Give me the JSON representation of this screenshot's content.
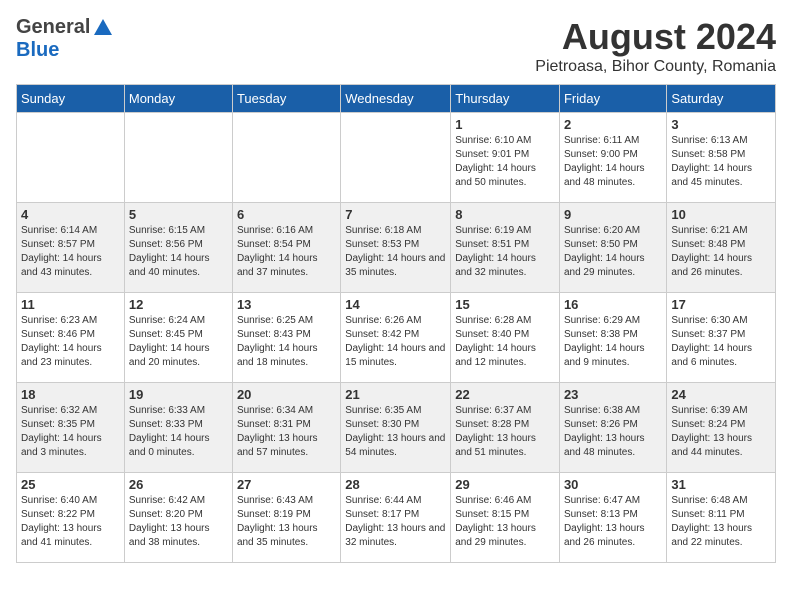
{
  "logo": {
    "general": "General",
    "blue": "Blue"
  },
  "title": {
    "month_year": "August 2024",
    "location": "Pietroasa, Bihor County, Romania"
  },
  "weekdays": [
    "Sunday",
    "Monday",
    "Tuesday",
    "Wednesday",
    "Thursday",
    "Friday",
    "Saturday"
  ],
  "weeks": [
    [
      {
        "day": "",
        "info": ""
      },
      {
        "day": "",
        "info": ""
      },
      {
        "day": "",
        "info": ""
      },
      {
        "day": "",
        "info": ""
      },
      {
        "day": "1",
        "info": "Sunrise: 6:10 AM\nSunset: 9:01 PM\nDaylight: 14 hours and 50 minutes."
      },
      {
        "day": "2",
        "info": "Sunrise: 6:11 AM\nSunset: 9:00 PM\nDaylight: 14 hours and 48 minutes."
      },
      {
        "day": "3",
        "info": "Sunrise: 6:13 AM\nSunset: 8:58 PM\nDaylight: 14 hours and 45 minutes."
      }
    ],
    [
      {
        "day": "4",
        "info": "Sunrise: 6:14 AM\nSunset: 8:57 PM\nDaylight: 14 hours and 43 minutes."
      },
      {
        "day": "5",
        "info": "Sunrise: 6:15 AM\nSunset: 8:56 PM\nDaylight: 14 hours and 40 minutes."
      },
      {
        "day": "6",
        "info": "Sunrise: 6:16 AM\nSunset: 8:54 PM\nDaylight: 14 hours and 37 minutes."
      },
      {
        "day": "7",
        "info": "Sunrise: 6:18 AM\nSunset: 8:53 PM\nDaylight: 14 hours and 35 minutes."
      },
      {
        "day": "8",
        "info": "Sunrise: 6:19 AM\nSunset: 8:51 PM\nDaylight: 14 hours and 32 minutes."
      },
      {
        "day": "9",
        "info": "Sunrise: 6:20 AM\nSunset: 8:50 PM\nDaylight: 14 hours and 29 minutes."
      },
      {
        "day": "10",
        "info": "Sunrise: 6:21 AM\nSunset: 8:48 PM\nDaylight: 14 hours and 26 minutes."
      }
    ],
    [
      {
        "day": "11",
        "info": "Sunrise: 6:23 AM\nSunset: 8:46 PM\nDaylight: 14 hours and 23 minutes."
      },
      {
        "day": "12",
        "info": "Sunrise: 6:24 AM\nSunset: 8:45 PM\nDaylight: 14 hours and 20 minutes."
      },
      {
        "day": "13",
        "info": "Sunrise: 6:25 AM\nSunset: 8:43 PM\nDaylight: 14 hours and 18 minutes."
      },
      {
        "day": "14",
        "info": "Sunrise: 6:26 AM\nSunset: 8:42 PM\nDaylight: 14 hours and 15 minutes."
      },
      {
        "day": "15",
        "info": "Sunrise: 6:28 AM\nSunset: 8:40 PM\nDaylight: 14 hours and 12 minutes."
      },
      {
        "day": "16",
        "info": "Sunrise: 6:29 AM\nSunset: 8:38 PM\nDaylight: 14 hours and 9 minutes."
      },
      {
        "day": "17",
        "info": "Sunrise: 6:30 AM\nSunset: 8:37 PM\nDaylight: 14 hours and 6 minutes."
      }
    ],
    [
      {
        "day": "18",
        "info": "Sunrise: 6:32 AM\nSunset: 8:35 PM\nDaylight: 14 hours and 3 minutes."
      },
      {
        "day": "19",
        "info": "Sunrise: 6:33 AM\nSunset: 8:33 PM\nDaylight: 14 hours and 0 minutes."
      },
      {
        "day": "20",
        "info": "Sunrise: 6:34 AM\nSunset: 8:31 PM\nDaylight: 13 hours and 57 minutes."
      },
      {
        "day": "21",
        "info": "Sunrise: 6:35 AM\nSunset: 8:30 PM\nDaylight: 13 hours and 54 minutes."
      },
      {
        "day": "22",
        "info": "Sunrise: 6:37 AM\nSunset: 8:28 PM\nDaylight: 13 hours and 51 minutes."
      },
      {
        "day": "23",
        "info": "Sunrise: 6:38 AM\nSunset: 8:26 PM\nDaylight: 13 hours and 48 minutes."
      },
      {
        "day": "24",
        "info": "Sunrise: 6:39 AM\nSunset: 8:24 PM\nDaylight: 13 hours and 44 minutes."
      }
    ],
    [
      {
        "day": "25",
        "info": "Sunrise: 6:40 AM\nSunset: 8:22 PM\nDaylight: 13 hours and 41 minutes."
      },
      {
        "day": "26",
        "info": "Sunrise: 6:42 AM\nSunset: 8:20 PM\nDaylight: 13 hours and 38 minutes."
      },
      {
        "day": "27",
        "info": "Sunrise: 6:43 AM\nSunset: 8:19 PM\nDaylight: 13 hours and 35 minutes."
      },
      {
        "day": "28",
        "info": "Sunrise: 6:44 AM\nSunset: 8:17 PM\nDaylight: 13 hours and 32 minutes."
      },
      {
        "day": "29",
        "info": "Sunrise: 6:46 AM\nSunset: 8:15 PM\nDaylight: 13 hours and 29 minutes."
      },
      {
        "day": "30",
        "info": "Sunrise: 6:47 AM\nSunset: 8:13 PM\nDaylight: 13 hours and 26 minutes."
      },
      {
        "day": "31",
        "info": "Sunrise: 6:48 AM\nSunset: 8:11 PM\nDaylight: 13 hours and 22 minutes."
      }
    ]
  ]
}
